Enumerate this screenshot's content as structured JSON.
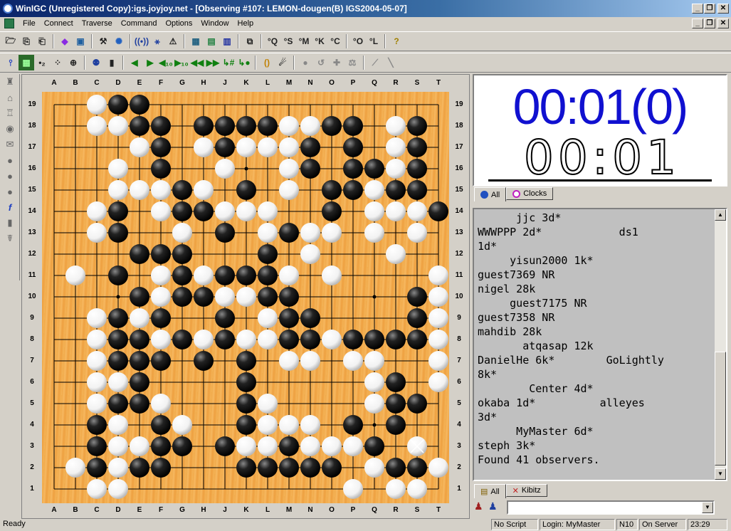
{
  "window": {
    "title": "WinIGC (Unregistered Copy):igs.joyjoy.net - [Observing #107: LEMON-dougen(B) IGS2004-05-07]",
    "min_glyph": "_",
    "restore_glyph": "❐",
    "close_glyph": "✕"
  },
  "menu": [
    "File",
    "Connect",
    "Traverse",
    "Command",
    "Options",
    "Window",
    "Help"
  ],
  "toolbar1": [
    "open-icon",
    "save-icon",
    "save-as-icon",
    "connect-icon",
    "network-icon",
    "hammer-icon",
    "settings-icon",
    "antenna-icon",
    "users-icon",
    "triangle-icon",
    "board-icon",
    "list-icon",
    "grid-icon",
    "windows-icon",
    "°Q",
    "°S",
    "°M",
    "°K",
    "°C",
    "°O",
    "°L",
    "help-icon"
  ],
  "toolbar2": [
    "marker-icon",
    "grid-icon",
    "number-icon",
    "dots-icon",
    "circle-icon",
    "players-icon",
    "trash-icon",
    "first-icon",
    "prev-icon",
    "prev10-icon",
    "next10-icon",
    "back-fast-icon",
    "fwd-fast-icon",
    "jump-icon",
    "end-icon",
    "balance-icon",
    "stones-icon",
    "gray-stone-icon",
    "undo-icon",
    "plus-icon",
    "scale-icon",
    "pencil-icon",
    "line-icon"
  ],
  "board": {
    "columns": [
      "A",
      "B",
      "C",
      "D",
      "E",
      "F",
      "G",
      "H",
      "J",
      "K",
      "L",
      "M",
      "N",
      "O",
      "P",
      "Q",
      "R",
      "S",
      "T"
    ],
    "rows": [
      "19",
      "18",
      "17",
      "16",
      "15",
      "14",
      "13",
      "12",
      "11",
      "10",
      "9",
      "8",
      "7",
      "6",
      "5",
      "4",
      "3",
      "2",
      "1"
    ],
    "stones": [
      "19|..WBB..............",
      "18|..WWBB.BBBBWWBB.WB.",
      "17|....WB.WBWWWB.B.WB.",
      "16|...W.B..W..WB.BBWB.",
      "15|...WWWBW.B.W.BBWBB.",
      "14|..WB.WBBWWW..B.WWWB",
      "13|..WB..W.B.WBWW.W.W.",
      "12|....BBB...B.W...W..",
      "11|.W.B.WBWBBBW.W....W",
      "10|....BWBBWWBB.....BW",
      "9|..WBWB..B.WBB....BW",
      "8|..WBBWBWBWWBBWBBBBW",
      "7|..WBBB.B.B.WW.WW..W",
      "6|..WWB....B.....WB.W",
      "5|..WBBW...BW....WBB.",
      "4|..BW.BW..BWWW.B.B..",
      "3|..BWWBB.BWWBWWWB.W.",
      "2|.WBWBB...BBBBB.WBBW",
      "1|..WW..........W.WW."
    ],
    "last_move": "S3",
    "hoshi": [
      "D16",
      "K16",
      "Q16",
      "D10",
      "K10",
      "Q10",
      "D4",
      "K4",
      "Q4"
    ]
  },
  "clock": {
    "top": "00:01(0)",
    "bottom": "00:01",
    "top_color": "#1010d0"
  },
  "clock_tabs": [
    "All",
    "Clocks"
  ],
  "chat": {
    "lines": [
      "      jjc 3d*",
      "WWWPPP 2d*            ds1",
      "1d*",
      "     yisun2000 1k*",
      "guest7369 NR",
      "nigel 28k",
      "     guest7175 NR",
      "guest7358 NR",
      "mahdib 28k",
      "       atqasap 12k",
      "DanielHe 6k*        GoLightly",
      "8k*",
      "        Center 4d*",
      "okaba 1d*          alleyes",
      "3d*",
      "      MyMaster 6d*",
      "steph 3k*",
      "Found 41 observers."
    ]
  },
  "chat_tabs": [
    "All",
    "Kibitz"
  ],
  "input": {
    "value": ""
  },
  "status": {
    "left": "Ready",
    "script": "No Script",
    "login": "Login: MyMaster",
    "n": "N10",
    "server": "On Server",
    "time": "23:29"
  }
}
